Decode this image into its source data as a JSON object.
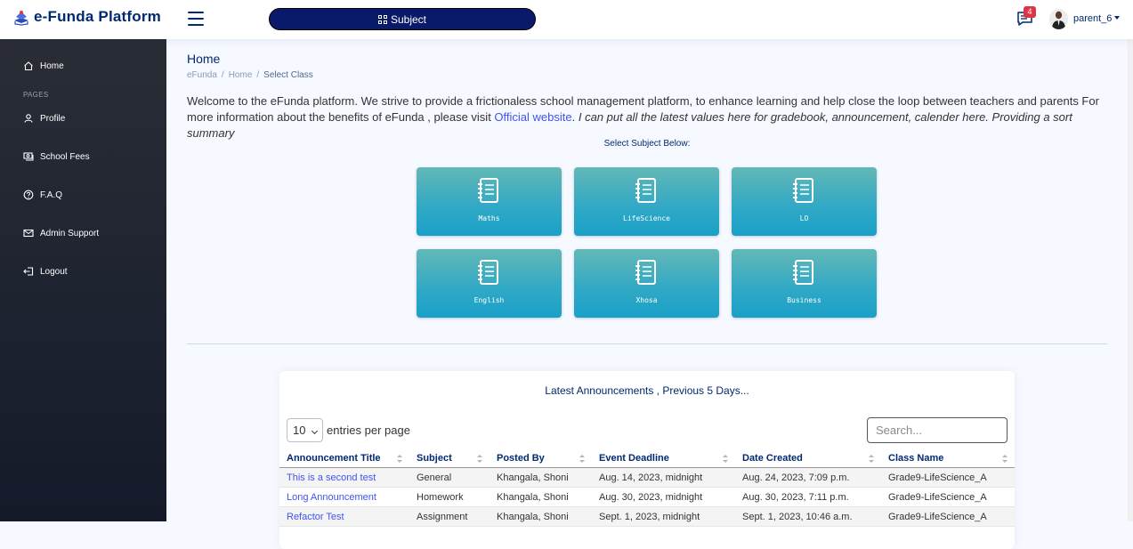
{
  "app": {
    "title": "e-Funda Platform"
  },
  "header": {
    "subject_button": "Subject",
    "notifications_count": "4",
    "username": "parent_6"
  },
  "sidebar": {
    "items": [
      {
        "label": "Home",
        "icon": "home-icon"
      },
      {
        "label": "Profile",
        "icon": "user-icon"
      },
      {
        "label": "School Fees",
        "icon": "money-icon"
      },
      {
        "label": "F.A.Q",
        "icon": "question-icon"
      },
      {
        "label": "Admin Support",
        "icon": "envelope-icon"
      },
      {
        "label": "Logout",
        "icon": "logout-icon"
      }
    ],
    "section_heading": "PAGES"
  },
  "page": {
    "title": "Home",
    "breadcrumb": [
      "eFunda",
      "Home",
      "Select Class"
    ],
    "welcome_text": "Welcome to the eFunda platform. We strive to provide a frictionaless school management platform, to enhance learning and help close the loop between teachers and parents For more information about the benefits of eFunda , please visit ",
    "welcome_link": "Official website",
    "welcome_note": "I can put all the latest values here for gradebook, announcement, calender here. Providing a sort summary",
    "select_label": "Select Subject Below:"
  },
  "subjects": [
    "Maths",
    "LifeScience",
    "LO",
    "English",
    "Xhosa",
    "Business"
  ],
  "announcements": {
    "title": "Latest Announcements , Previous 5 Days...",
    "page_length": "10",
    "length_label": "entries per page",
    "search_placeholder": "Search...",
    "columns": [
      "Announcement Title",
      "Subject",
      "Posted By",
      "Event Deadline",
      "Date Created",
      "Class Name"
    ],
    "rows": [
      [
        "This is a second test",
        "General",
        "Khangala, Shoni",
        "Aug. 14, 2023, midnight",
        "Aug. 24, 2023, 7:09 p.m.",
        "Grade9-LifeScience_A"
      ],
      [
        "Long Announcement",
        "Homework",
        "Khangala, Shoni",
        "Aug. 30, 2023, midnight",
        "Aug. 30, 2023, 7:11 p.m.",
        "Grade9-LifeScience_A"
      ],
      [
        "Refactor Test",
        "Assignment",
        "Khangala, Shoni",
        "Sept. 1, 2023, midnight",
        "Sept. 1, 2023, 10:46 a.m.",
        "Grade9-LifeScience_A"
      ]
    ]
  },
  "colors": {
    "brand": "#012970",
    "link": "#4154f1",
    "tile": "#2fa8c6",
    "badge": "#dc3545"
  }
}
